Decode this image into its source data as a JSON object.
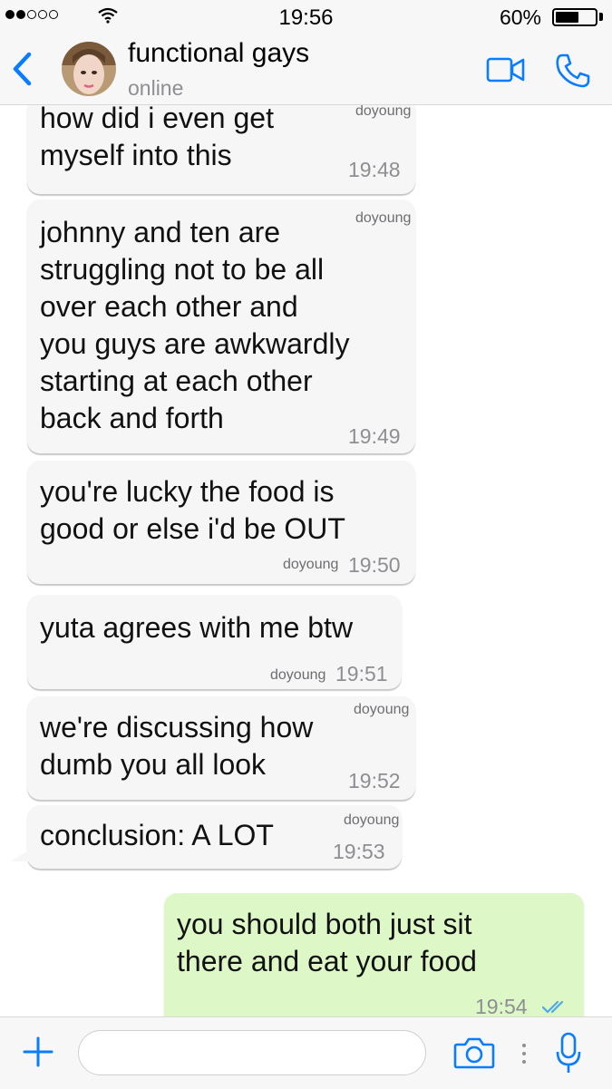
{
  "status_bar": {
    "time": "19:56",
    "battery": "60%",
    "battery_level": 0.6,
    "signal_bars_filled": 2,
    "signal_bars_total": 5
  },
  "header": {
    "back_icon": "chevron-left-icon",
    "title": "functional gays",
    "subtitle": "online",
    "video_icon": "video-camera-icon",
    "call_icon": "phone-icon"
  },
  "messages": [
    {
      "text": [
        "how did i even get",
        "myself into this"
      ],
      "sender": "doyoung",
      "time": "19:48",
      "direction": "incoming"
    },
    {
      "text": [
        "johnny and ten are",
        "struggling not to be all",
        "over each other and",
        "you guys are awkwardly",
        "starting at each other",
        "back and forth"
      ],
      "sender": "doyoung",
      "time": "19:49",
      "direction": "incoming"
    },
    {
      "text": [
        "you're lucky the food is",
        "good or else i'd be OUT"
      ],
      "sender": "doyoung",
      "time": "19:50",
      "direction": "incoming"
    },
    {
      "text": [
        "yuta agrees with me btw"
      ],
      "sender": "doyoung",
      "time": "19:51",
      "direction": "incoming"
    },
    {
      "text": [
        "we're discussing how",
        "dumb you all look"
      ],
      "sender": "doyoung",
      "time": "19:52",
      "direction": "incoming"
    },
    {
      "text": [
        "conclusion: A LOT"
      ],
      "sender": "doyoung",
      "time": "19:53",
      "direction": "incoming"
    },
    {
      "text": [
        "you should both just sit",
        "there and eat your food"
      ],
      "sender": "",
      "time": "19:54",
      "direction": "outgoing",
      "status": "read"
    }
  ],
  "input_bar": {
    "plus_icon": "plus-icon",
    "placeholder": "",
    "camera_icon": "camera-icon",
    "mic_icon": "microphone-icon"
  },
  "colors": {
    "accent": "#0a7cff",
    "incoming_bubble": "#f6f6f6",
    "outgoing_bubble": "#ddf8c6",
    "read_ticks": "#4fa8e8"
  }
}
